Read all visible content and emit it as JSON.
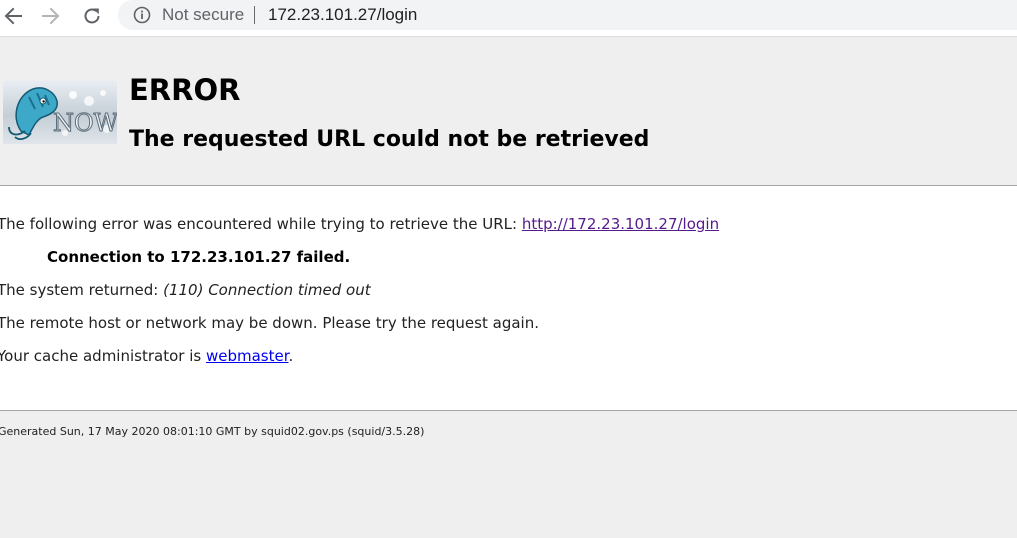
{
  "browser": {
    "security_label": "Not secure",
    "url": "172.23.101.27/login"
  },
  "logo": {
    "text": "NOW"
  },
  "page": {
    "title": "ERROR",
    "subtitle": "The requested URL could not be retrieved",
    "intro_text": "The following error was encountered while trying to retrieve the URL: ",
    "requested_url": "http://172.23.101.27/login",
    "failure_message": "Connection to 172.23.101.27 failed.",
    "system_returned_label": "The system returned: ",
    "system_returned_value": "(110) Connection timed out",
    "advice": "The remote host or network may be down. Please try the request again.",
    "admin_text": "Your cache administrator is ",
    "admin_link": "webmaster",
    "admin_suffix": ".",
    "footer": "Generated Sun, 17 May 2020 08:01:10 GMT by squid02.gov.ps (squid/3.5.28)"
  },
  "colors": {
    "visited_link": "#551a8b",
    "link": "#0000ee",
    "page_background": "#efefef"
  },
  "icons": [
    "back-arrow-icon",
    "forward-arrow-icon",
    "reload-icon",
    "info-icon"
  ]
}
